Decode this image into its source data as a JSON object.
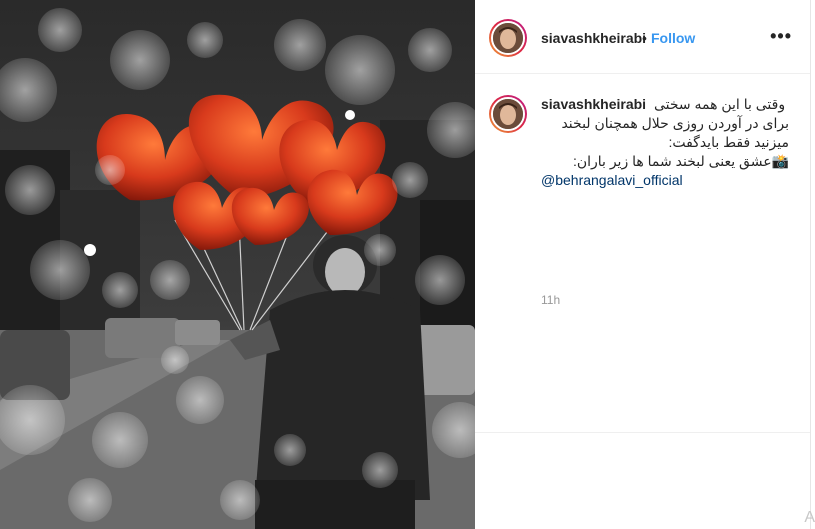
{
  "post": {
    "username": "siavashkheirabi",
    "separator": "•",
    "follow_label": "Follow",
    "more_label": "•••"
  },
  "caption": {
    "username": "siavashkheirabi",
    "line1": "وقتی با این همه سختی",
    "line2": "برای در آوردن روزی حلال همچنان لبخند",
    "line3": "میزنید فقط بایدگفت:",
    "line4": "📸عشق یعنی لبخند شما ها زیر باران:",
    "mention": "@behrangalavi_official",
    "time": "11h"
  },
  "icons": {
    "avatar": "profile-avatar-icon",
    "more": "more-options-icon"
  },
  "colors": {
    "link_blue": "#3897f0",
    "mention": "#003569",
    "muted": "#999999",
    "balloon_red": "#d83a1c"
  },
  "corner_text": "A"
}
